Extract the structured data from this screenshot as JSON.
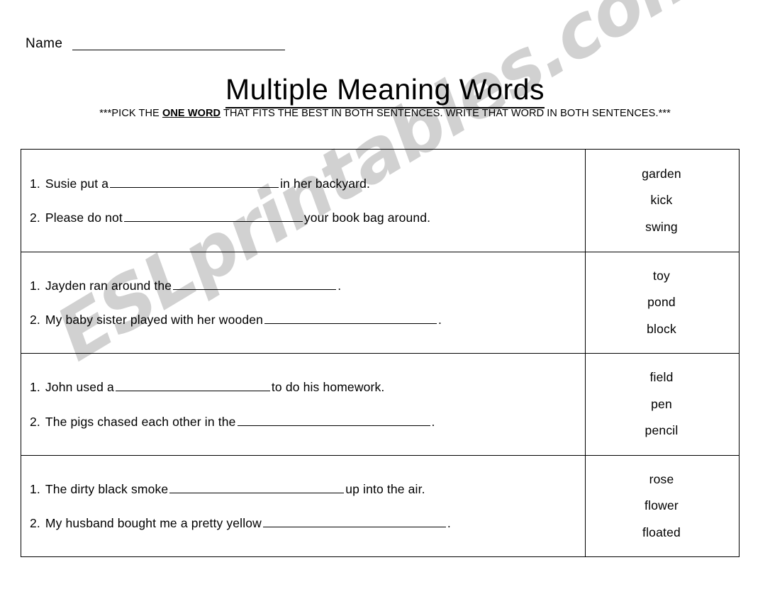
{
  "header": {
    "name_label": "Name",
    "title": "Multiple Meaning Words",
    "subtitle_before": "***PICK THE ",
    "subtitle_emphasis": "ONE WORD",
    "subtitle_after": " THAT FITS THE BEST IN BOTH SENTENCES.  WRITE THAT WORD IN BOTH SENTENCES.***"
  },
  "colors": {
    "ink": "#000000",
    "paper": "#ffffff",
    "watermark": "#c9c9c9"
  },
  "watermark": {
    "text": "ESLprintables.com"
  },
  "items": [
    {
      "sentences": [
        {
          "number": "1.",
          "before": "Susie put a",
          "after": "in her backyard."
        },
        {
          "number": "2.",
          "before": "Please do not",
          "after": "your book bag around."
        }
      ],
      "words": [
        "garden",
        "kick",
        "swing"
      ]
    },
    {
      "sentences": [
        {
          "number": "1.",
          "before": "Jayden ran around the",
          "after": "."
        },
        {
          "number": "2.",
          "before": "My baby sister played with her wooden",
          "after": "."
        }
      ],
      "words": [
        "toy",
        "pond",
        "block"
      ]
    },
    {
      "sentences": [
        {
          "number": "1.",
          "before": "John used a",
          "after": "to do his homework."
        },
        {
          "number": "2.",
          "before": "The pigs chased each other in the",
          "after": "."
        }
      ],
      "words": [
        "field",
        "pen",
        "pencil"
      ]
    },
    {
      "sentences": [
        {
          "number": "1.",
          "before": "The dirty black smoke",
          "after": "up into the air."
        },
        {
          "number": "2.",
          "before": "My husband bought me a pretty yellow",
          "after": "."
        }
      ],
      "words": [
        "rose",
        "flower",
        "floated"
      ]
    }
  ]
}
